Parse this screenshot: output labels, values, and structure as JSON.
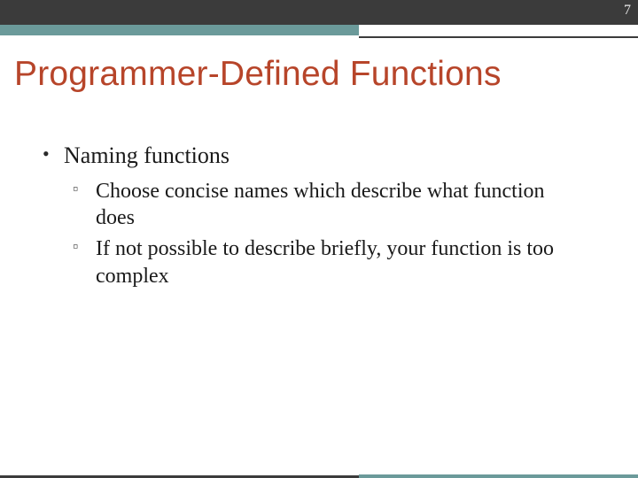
{
  "slide_number": "7",
  "title": "Programmer-Defined Functions",
  "colors": {
    "title": "#b7452a",
    "band_dark": "#3b3b3b",
    "band_teal": "#6b9a9a"
  },
  "bullets": {
    "lvl1_0": "Naming functions",
    "lvl2_0": "Choose concise names which describe what function does",
    "lvl2_1": "If not possible to describe briefly, your function is too complex"
  }
}
